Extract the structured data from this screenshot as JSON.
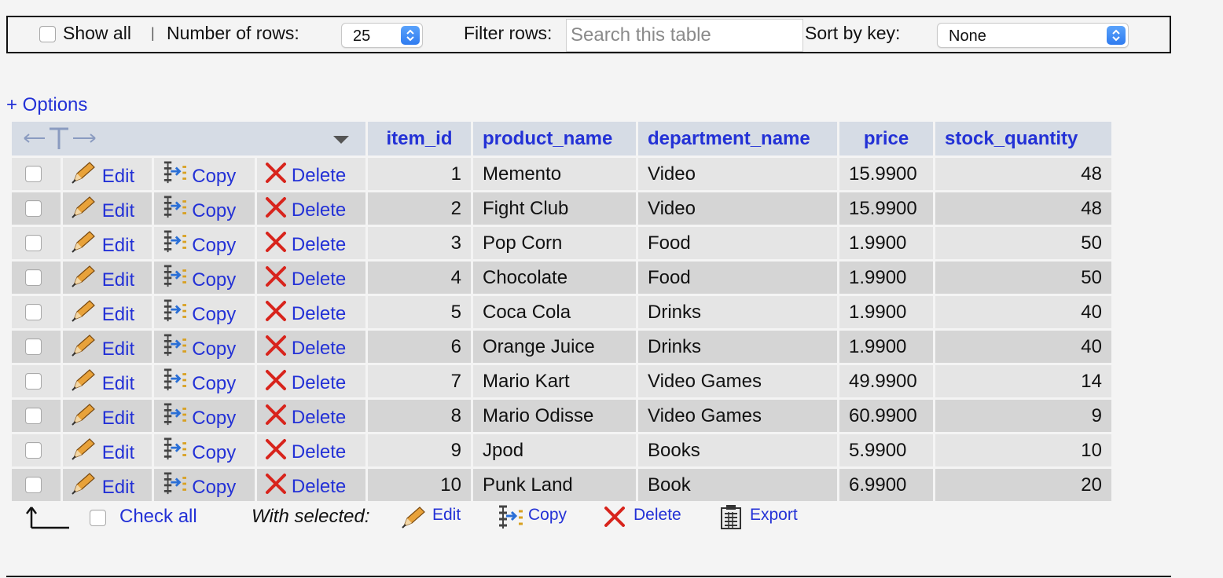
{
  "navbar": {
    "show_all_label": "Show all",
    "separator": "|",
    "rows_label": "Number of rows:",
    "rows_value": "25",
    "filter_label": "Filter rows:",
    "filter_placeholder": "Search this table",
    "sort_label": "Sort by key:",
    "sort_value": "None"
  },
  "options_label": "+ Options",
  "table": {
    "columns": [
      "item_id",
      "product_name",
      "department_name",
      "price",
      "stock_quantity"
    ],
    "actions": {
      "edit": "Edit",
      "copy": "Copy",
      "delete": "Delete"
    },
    "rows": [
      {
        "item_id": "1",
        "product_name": "Memento",
        "department_name": "Video",
        "price": "15.9900",
        "stock_quantity": "48"
      },
      {
        "item_id": "2",
        "product_name": "Fight Club",
        "department_name": "Video",
        "price": "15.9900",
        "stock_quantity": "48"
      },
      {
        "item_id": "3",
        "product_name": "Pop Corn",
        "department_name": "Food",
        "price": "1.9900",
        "stock_quantity": "50"
      },
      {
        "item_id": "4",
        "product_name": "Chocolate",
        "department_name": "Food",
        "price": "1.9900",
        "stock_quantity": "50"
      },
      {
        "item_id": "5",
        "product_name": "Coca Cola",
        "department_name": "Drinks",
        "price": "1.9900",
        "stock_quantity": "40"
      },
      {
        "item_id": "6",
        "product_name": "Orange Juice",
        "department_name": "Drinks",
        "price": "1.9900",
        "stock_quantity": "40"
      },
      {
        "item_id": "7",
        "product_name": "Mario Kart",
        "department_name": "Video Games",
        "price": "49.9900",
        "stock_quantity": "14"
      },
      {
        "item_id": "8",
        "product_name": "Mario Odisse",
        "department_name": "Video Games",
        "price": "60.9900",
        "stock_quantity": "9"
      },
      {
        "item_id": "9",
        "product_name": "Jpod",
        "department_name": "Books",
        "price": "5.9900",
        "stock_quantity": "10"
      },
      {
        "item_id": "10",
        "product_name": "Punk Land",
        "department_name": "Book",
        "price": "6.9900",
        "stock_quantity": "20"
      }
    ]
  },
  "footer": {
    "check_all_label": "Check all",
    "with_selected_label": "With selected:",
    "edit_label": "Edit",
    "copy_label": "Copy",
    "delete_label": "Delete",
    "export_label": "Export"
  },
  "colors": {
    "link": "#2331d6",
    "header_bg": "#d6dce5",
    "row_odd": "#e5e5e5",
    "row_even": "#d5d5d5",
    "delete_red": "#d8241c"
  }
}
